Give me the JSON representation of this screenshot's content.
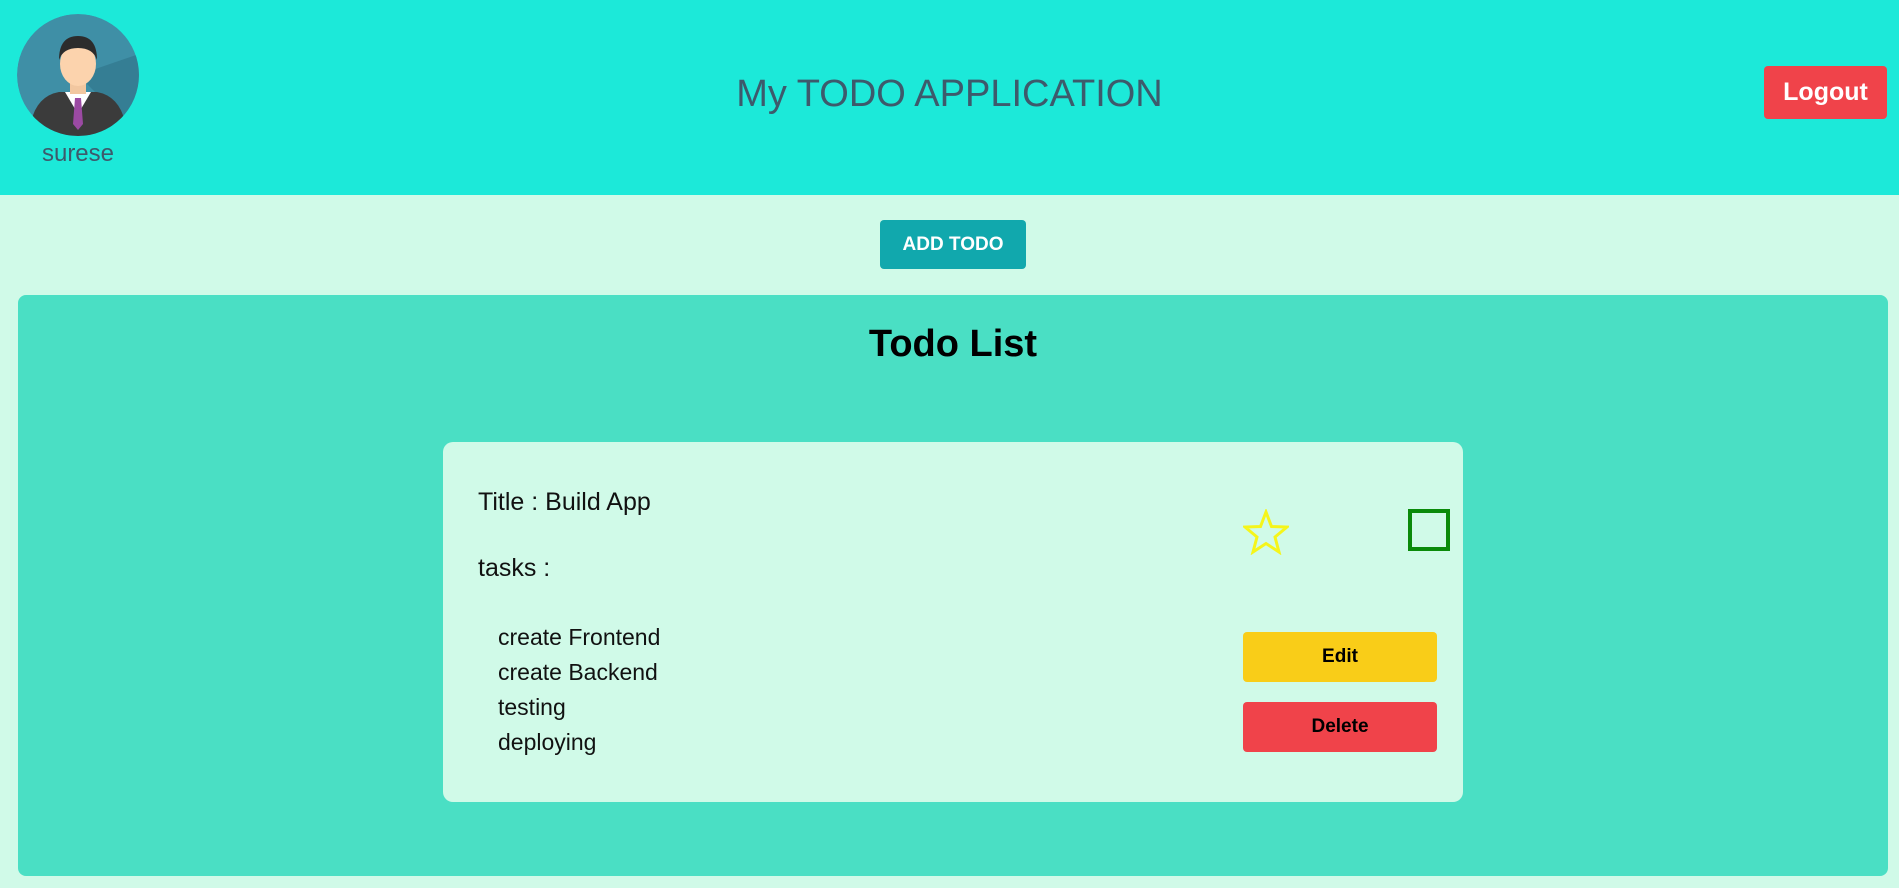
{
  "header": {
    "user": {
      "name": "surese",
      "avatar_icon": "user-avatar-icon"
    },
    "app_title": "My TODO APPLICATION",
    "logout_label": "Logout"
  },
  "toolbar": {
    "add_todo_label": "ADD TODO"
  },
  "todo_list": {
    "heading": "Todo List",
    "items": [
      {
        "title_text": "Title : Build App",
        "tasks_label": "tasks :",
        "tasks": [
          "create Frontend",
          "create Backend",
          "testing",
          "deploying"
        ],
        "starred": false,
        "completed": false,
        "edit_label": "Edit",
        "delete_label": "Delete"
      }
    ]
  },
  "colors": {
    "header_bg": "#1ce9d9",
    "page_bg": "#d0fae8",
    "panel_bg": "#4adfc4",
    "add_button": "#11a8ad",
    "logout_button": "#f0434a",
    "edit_button": "#f9cd18",
    "delete_button": "#f0434a",
    "star": "#f5f51a",
    "checkbox_border": "#0a8a0a"
  }
}
